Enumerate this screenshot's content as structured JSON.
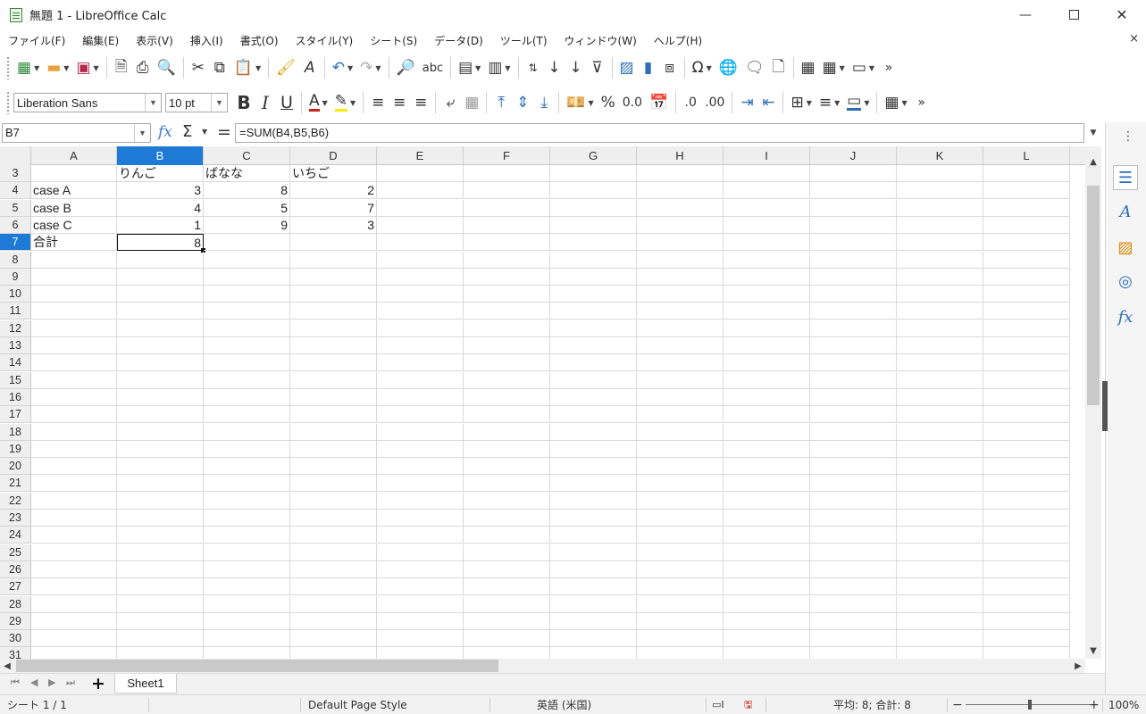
{
  "window": {
    "title": "無題 1 - LibreOffice Calc",
    "minimize_icon": "minimize-icon",
    "maximize_icon": "maximize-icon",
    "close_icon": "close-icon"
  },
  "menubar": {
    "items": [
      "ファイル(F)",
      "編集(E)",
      "表示(V)",
      "挿入(I)",
      "書式(O)",
      "スタイル(Y)",
      "シート(S)",
      "データ(D)",
      "ツール(T)",
      "ウィンドウ(W)",
      "ヘルプ(H)"
    ],
    "close_doc": "×"
  },
  "toolbar": {
    "abc": "abc",
    "percent": "%",
    "decimal": "0.0",
    "add_decimal": ".0",
    "del_decimal": ".00"
  },
  "formatting": {
    "font_name": "Liberation Sans",
    "font_size": "10 pt",
    "bold": "B",
    "italic": "I",
    "underline": "U"
  },
  "formula_bar": {
    "name_box": "B7",
    "formula": "=SUM(B4,B5,B6)",
    "fx": "fx",
    "sigma": "Σ",
    "equal": "="
  },
  "grid": {
    "columns": [
      "A",
      "B",
      "C",
      "D",
      "E",
      "F",
      "G",
      "H",
      "I",
      "J",
      "K",
      "L"
    ],
    "selected_column": "B",
    "selected_row": "7",
    "row_numbers": [
      "3",
      "4",
      "5",
      "6",
      "7",
      "8",
      "9",
      "10",
      "11",
      "12",
      "13",
      "14",
      "15",
      "16",
      "17",
      "18",
      "19",
      "20",
      "21",
      "22",
      "23",
      "24",
      "25",
      "26",
      "27",
      "28",
      "29",
      "30",
      "31"
    ],
    "cells": {
      "r3": [
        "",
        "りんご",
        "ばなな",
        "いちご"
      ],
      "r4": [
        "case A",
        "3",
        "8",
        "2"
      ],
      "r5": [
        "case B",
        "4",
        "5",
        "7"
      ],
      "r6": [
        "case C",
        "1",
        "9",
        "3"
      ],
      "r7": [
        "合計",
        "8",
        "",
        ""
      ]
    }
  },
  "sheet_tabs": {
    "tabs": [
      "Sheet1"
    ],
    "add": "+"
  },
  "statusbar": {
    "sheet_pos": "シート 1 / 1",
    "page_style": "Default Page Style",
    "language": "英語 (米国)",
    "summary": "平均: 8; 合計: 8",
    "zoom_minus": "−",
    "zoom_plus": "+",
    "zoom": "100%"
  },
  "sidebar": {
    "dots": "⋮",
    "icons": [
      "properties-icon",
      "styles-icon",
      "gallery-icon",
      "navigator-icon",
      "functions-icon"
    ]
  }
}
